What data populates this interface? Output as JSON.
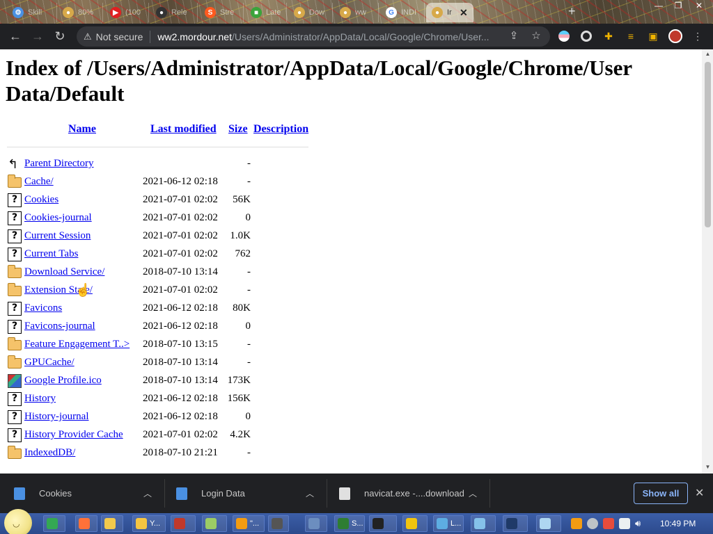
{
  "browser": {
    "tabs": [
      {
        "label": "Skill",
        "color": "#4a90e2",
        "glyph": "⚙"
      },
      {
        "label": "80%",
        "color": "#d7a94a",
        "glyph": "●"
      },
      {
        "label": "(100",
        "color": "#e02020",
        "glyph": "▶"
      },
      {
        "label": "Rele",
        "color": "#333333",
        "glyph": "●"
      },
      {
        "label": "Stre",
        "color": "#ff5a1f",
        "glyph": "S"
      },
      {
        "label": "Late",
        "color": "#3ba43b",
        "glyph": "■"
      },
      {
        "label": "Dow",
        "color": "#d7a94a",
        "glyph": "●"
      },
      {
        "label": "ww",
        "color": "#d7a94a",
        "glyph": "●"
      },
      {
        "label": "INDI",
        "color": "#ffffff",
        "glyph": "G"
      },
      {
        "label": "Ir",
        "color": "#d7a94a",
        "glyph": "●",
        "active": true
      }
    ],
    "new_tab": "+",
    "window_controls": [
      "—",
      "❐",
      "✕"
    ]
  },
  "toolbar": {
    "back_icon": "arrow-left",
    "forward_icon": "arrow-right",
    "reload_icon": "reload",
    "security_label": "Not secure",
    "url_host": "ww2.mordour.net",
    "url_path": "/Users/Administrator/AppData/Local/Google/Chrome/User..."
  },
  "page": {
    "title": "Index of /Users/Administrator/AppData/Local/Google/Chrome/User Data/Default",
    "columns": {
      "name": "Name",
      "last_modified": "Last modified",
      "size": "Size",
      "description": "Description"
    },
    "entries": [
      {
        "icon": "back",
        "name": "Parent Directory",
        "date": "",
        "size": "-"
      },
      {
        "icon": "folder",
        "name": "Cache/",
        "date": "2021-06-12 02:18",
        "size": "-"
      },
      {
        "icon": "unknown",
        "name": "Cookies",
        "date": "2021-07-01 02:02",
        "size": "56K"
      },
      {
        "icon": "unknown",
        "name": "Cookies-journal",
        "date": "2021-07-01 02:02",
        "size": "0"
      },
      {
        "icon": "unknown",
        "name": "Current Session",
        "date": "2021-07-01 02:02",
        "size": "1.0K"
      },
      {
        "icon": "unknown",
        "name": "Current Tabs",
        "date": "2021-07-01 02:02",
        "size": "762"
      },
      {
        "icon": "folder",
        "name": "Download Service/",
        "date": "2018-07-10 13:14",
        "size": "-"
      },
      {
        "icon": "folder",
        "name": "Extension State/",
        "date": "2021-07-01 02:02",
        "size": "-"
      },
      {
        "icon": "unknown",
        "name": "Favicons",
        "date": "2021-06-12 02:18",
        "size": "80K"
      },
      {
        "icon": "unknown",
        "name": "Favicons-journal",
        "date": "2021-06-12 02:18",
        "size": "0"
      },
      {
        "icon": "folder",
        "name": "Feature Engagement T..>",
        "date": "2018-07-10 13:15",
        "size": "-"
      },
      {
        "icon": "folder",
        "name": "GPUCache/",
        "date": "2018-07-10 13:14",
        "size": "-"
      },
      {
        "icon": "image",
        "name": "Google Profile.ico",
        "date": "2018-07-10 13:14",
        "size": "173K"
      },
      {
        "icon": "unknown",
        "name": "History",
        "date": "2021-06-12 02:18",
        "size": "156K"
      },
      {
        "icon": "unknown",
        "name": "History-journal",
        "date": "2021-06-12 02:18",
        "size": "0"
      },
      {
        "icon": "unknown",
        "name": "History Provider Cache",
        "date": "2021-07-01 02:02",
        "size": "4.2K"
      },
      {
        "icon": "folder",
        "name": "IndexedDB/",
        "date": "2018-07-10 21:21",
        "size": "-"
      }
    ]
  },
  "downloads": {
    "items": [
      {
        "name": "Cookies",
        "icon_color": "#4a90e2"
      },
      {
        "name": "Login Data",
        "icon_color": "#4a90e2"
      },
      {
        "name": "navicat.exe -....download",
        "icon_color": "#e0e0e0"
      }
    ],
    "show_all_label": "Show all"
  },
  "taskbar": {
    "items": [
      {
        "label": "",
        "color": "#34a853"
      },
      {
        "label": "",
        "color": "#ff7139"
      },
      {
        "label": "",
        "color": "#f2c94c"
      },
      {
        "label": "Y...",
        "color": "#f5c542"
      },
      {
        "label": "",
        "color": "#c0392b"
      },
      {
        "label": "",
        "color": "#9ccc65"
      },
      {
        "label": "\"...",
        "color": "#f39c12"
      },
      {
        "label": "",
        "color": "#555555"
      },
      {
        "label": "",
        "color": "#6c8ebf"
      },
      {
        "label": "S...",
        "color": "#2e7d32"
      },
      {
        "label": "",
        "color": "#222222"
      },
      {
        "label": "",
        "color": "#f1c40f"
      },
      {
        "label": "L...",
        "color": "#5dade2"
      },
      {
        "label": "",
        "color": "#85c1e9"
      },
      {
        "label": "",
        "color": "#1f3a68"
      },
      {
        "label": "",
        "color": "#aed6f1"
      }
    ],
    "clock": "10:49 PM"
  }
}
